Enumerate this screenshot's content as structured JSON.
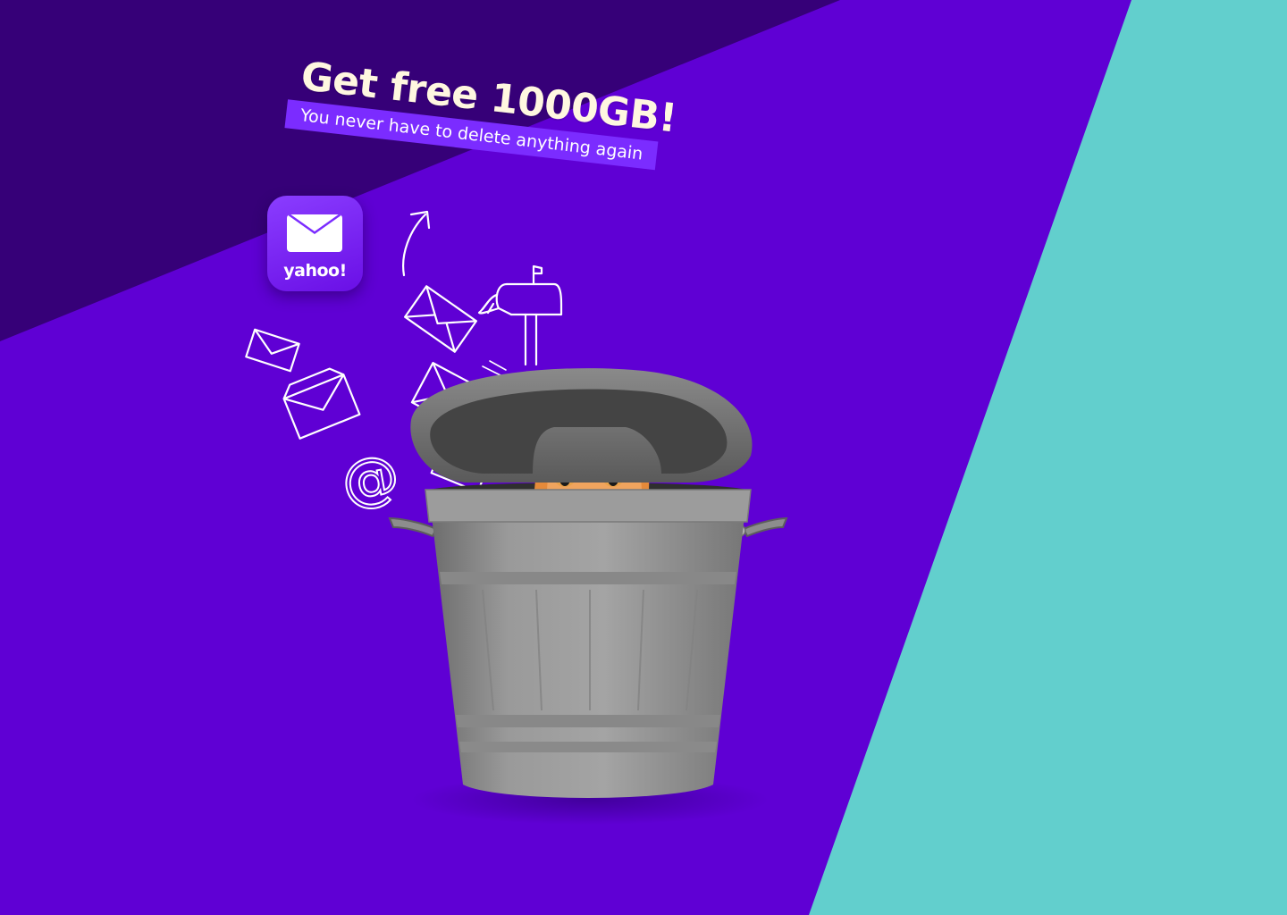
{
  "promo": {
    "headline": "Get free 1000GB!",
    "subheadline": "You never have to delete anything again"
  },
  "app_icon": {
    "wordmark": "yahoo!",
    "icon": "mail-envelope-icon"
  },
  "doodles": {
    "at_symbol": "@"
  },
  "colors": {
    "background_purple": "#5f00d4",
    "dark_purple_band": "#360078",
    "teal_band": "#62cfcd",
    "headline_cream": "#fff7e0",
    "subline_purple": "#7b2cff",
    "trash_can_gray": "#8e8e8e",
    "cat_orange": "#e58a3a"
  }
}
